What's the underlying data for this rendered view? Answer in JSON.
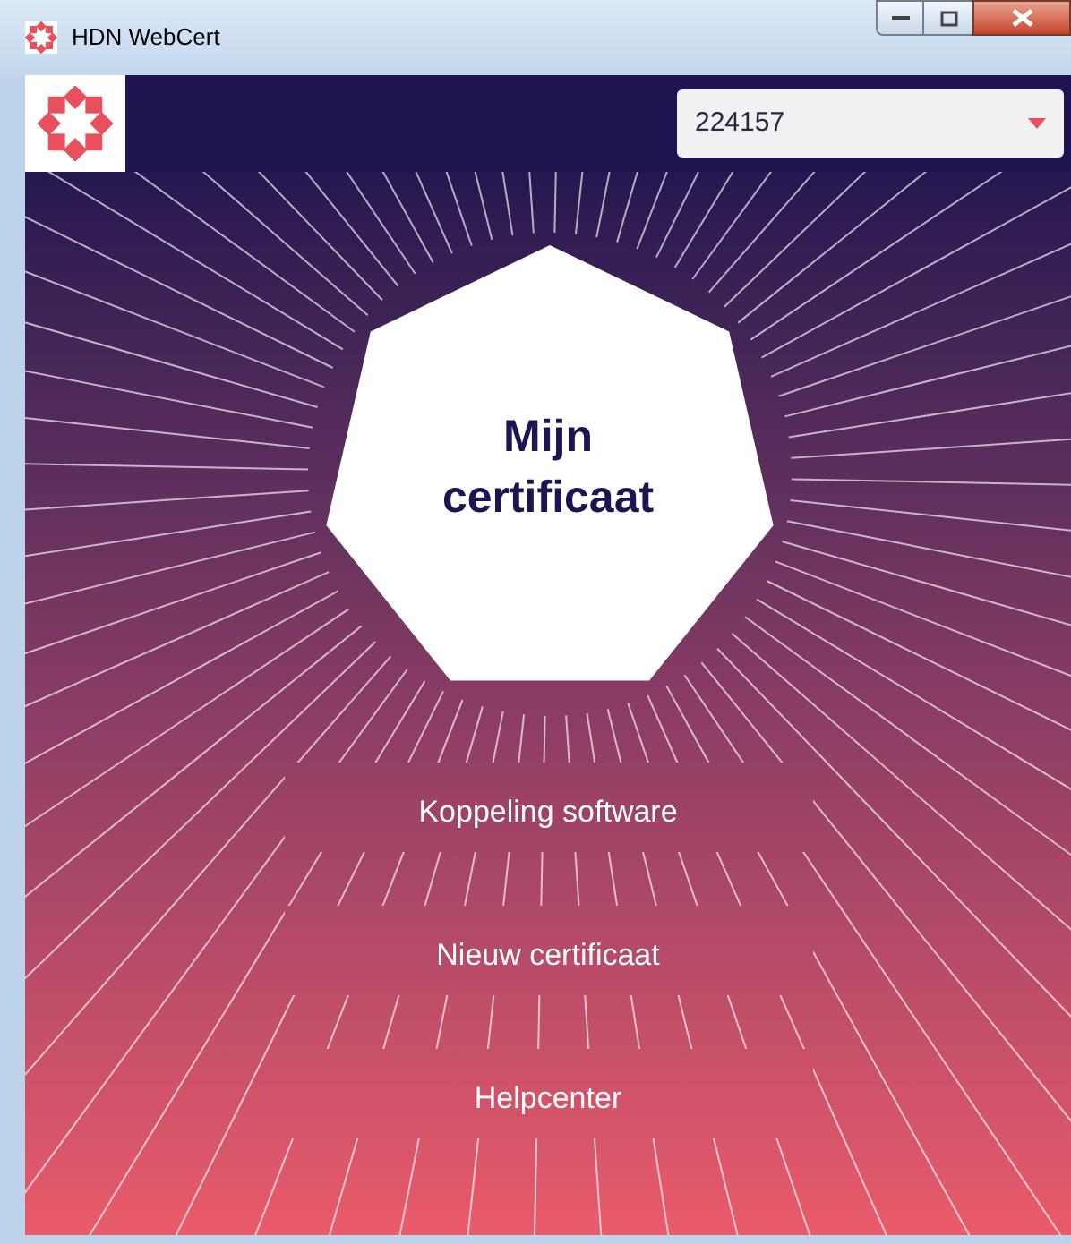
{
  "window": {
    "title": "HDN WebCert"
  },
  "account_select": {
    "value": "224157"
  },
  "heading": "Mijn certificaat",
  "menu": [
    {
      "label": "Koppeling software"
    },
    {
      "label": "Nieuw certificaat"
    },
    {
      "label": "Helpcenter"
    }
  ]
}
